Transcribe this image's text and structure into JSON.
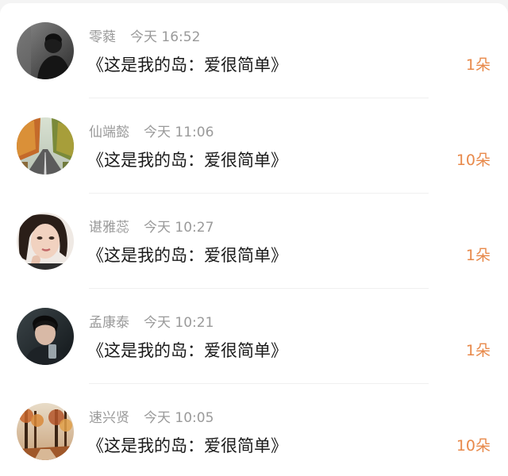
{
  "list": {
    "items": [
      {
        "name": "零蕤",
        "time": "今天 16:52",
        "title": "《这是我的岛：爱很简单》",
        "count": "1朵",
        "avatar_icon": "dark-portrait-avatar"
      },
      {
        "name": "仙端懿",
        "time": "今天 11:06",
        "title": "《这是我的岛：爱很简单》",
        "count": "10朵",
        "avatar_icon": "autumn-road-avatar"
      },
      {
        "name": "谌雅蕊",
        "time": "今天 10:27",
        "title": "《这是我的岛：爱很简单》",
        "count": "1朵",
        "avatar_icon": "woman-portrait-avatar"
      },
      {
        "name": "孟康泰",
        "time": "今天 10:21",
        "title": "《这是我的岛：爱很简单》",
        "count": "1朵",
        "avatar_icon": "man-portrait-avatar"
      },
      {
        "name": "速兴贤",
        "time": "今天 10:05",
        "title": "《这是我的岛：爱很简单》",
        "count": "10朵",
        "avatar_icon": "autumn-forest-avatar"
      }
    ]
  },
  "colors": {
    "accent": "#e8894a",
    "secondary_text": "#9a9a9a",
    "primary_text": "#1a1a1a"
  }
}
